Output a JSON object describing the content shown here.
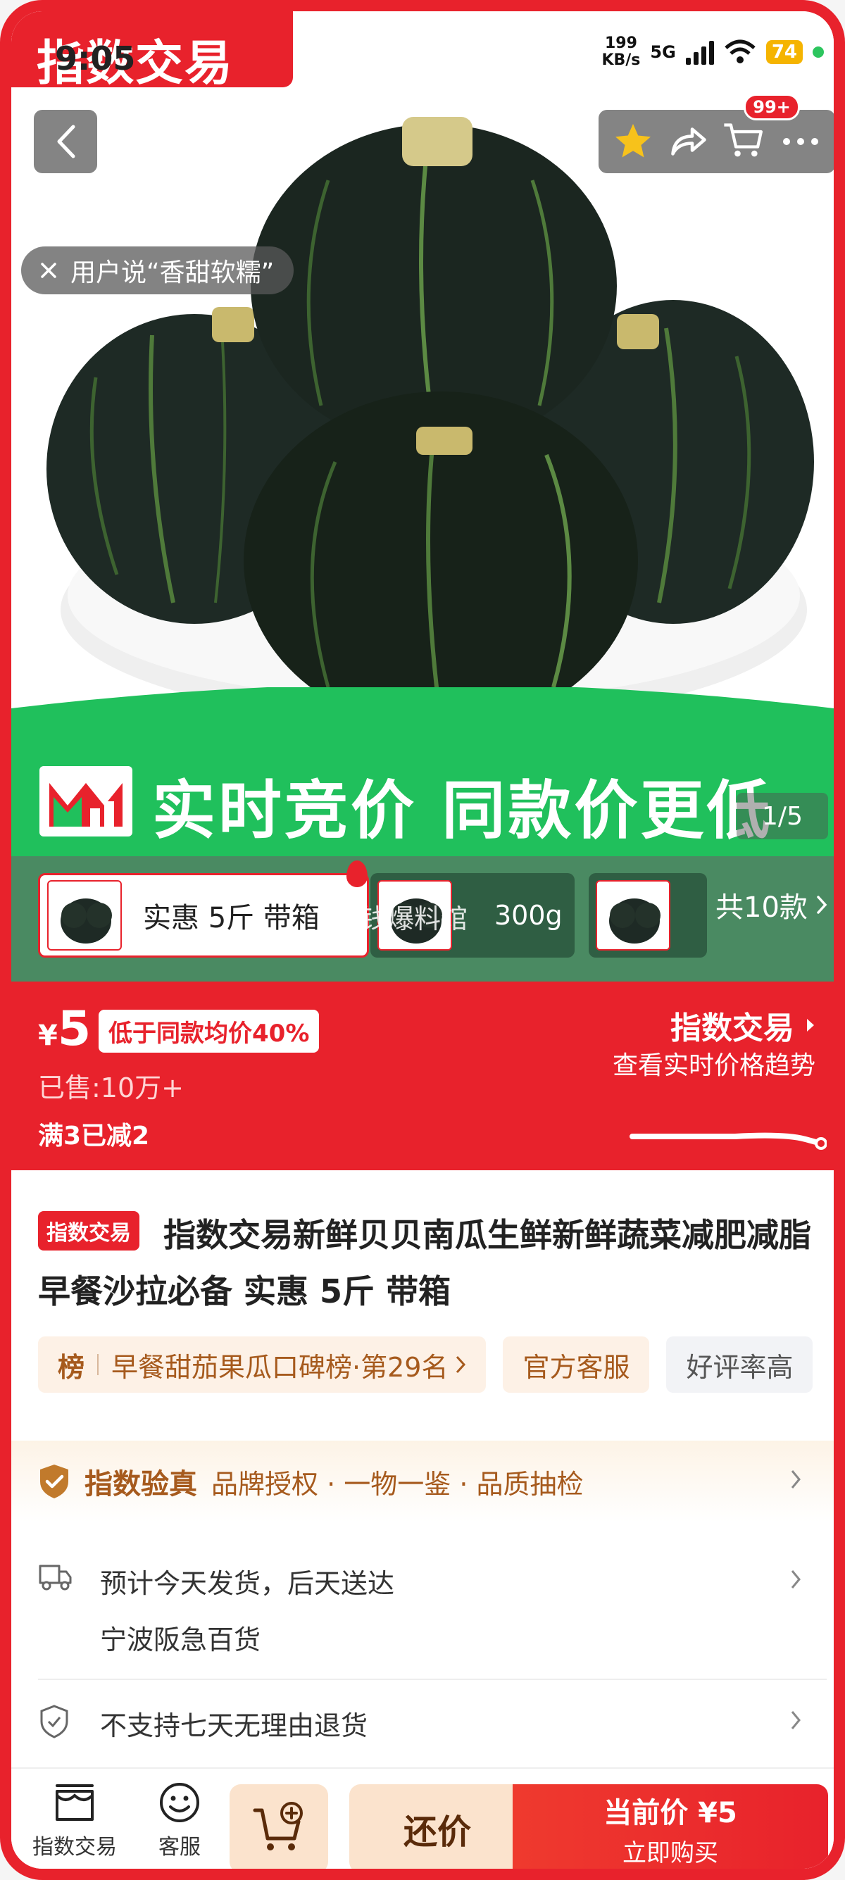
{
  "status_bar": {
    "time": "9:05",
    "net_speed_value": "199",
    "net_speed_unit": "KB/s",
    "signal_label": "5G",
    "battery": "74"
  },
  "hero": {
    "brand_tab": "指数交易",
    "cart_badge": "99+",
    "user_quote": "用户说“香甜软糯”",
    "image_subject": "pumpkins",
    "page_indicator": "1/5"
  },
  "banner": {
    "text": "实时竞价 同款价更低"
  },
  "sku": {
    "items": [
      {
        "label": "实惠 5斤 带箱"
      },
      {
        "label": "300g"
      },
      {
        "label": ""
      }
    ],
    "overlay_shop": "省钱爆料馆",
    "total": "共10款"
  },
  "price": {
    "currency": "¥",
    "value": "5",
    "discount_tag": "低于同款均价40%",
    "sold": "已售:10万+",
    "promo": "满3已减2",
    "index_title": "指数交易",
    "index_sub": "查看实时价格趋势"
  },
  "title": {
    "badge": "指数交易",
    "text": "指数交易新鲜贝贝南瓜生鲜新鲜蔬菜减肥减脂早餐沙拉必备 实惠 5斤 带箱",
    "chips": {
      "rank_label": "榜",
      "rank_text": "早餐甜茄果瓜口碑榜·第29名",
      "service": "官方客服",
      "rating": "好评率高"
    }
  },
  "verify": {
    "title": "指数验真",
    "sub": "品牌授权 · 一物一鉴 · 品质抽检"
  },
  "shipping": {
    "line1": "预计今天发货，后天送达",
    "line2": "宁波阪急百货"
  },
  "returns": {
    "text": "不支持七天无理由退货"
  },
  "bottom_bar": {
    "shop_label": "指数交易",
    "service_label": "客服",
    "haggle_label": "还价",
    "buy_price": "当前价 ¥5",
    "buy_label": "立即购买"
  },
  "colors": {
    "brand_red": "#e8222c",
    "banner_green": "#20c05c",
    "chip_brown": "#a65a1d"
  }
}
